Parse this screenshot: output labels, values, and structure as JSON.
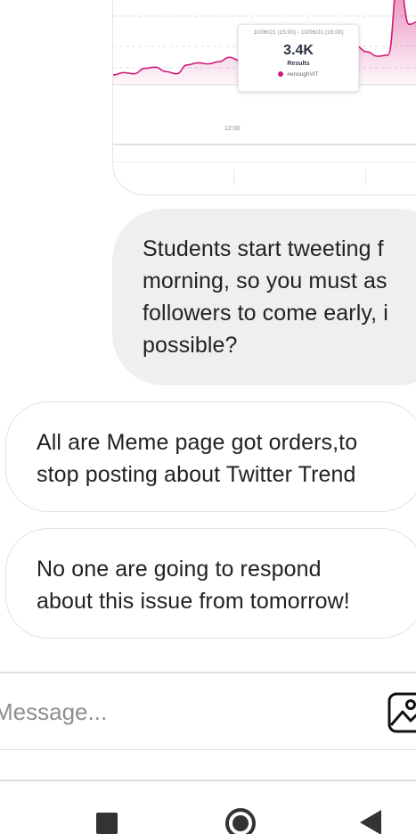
{
  "shared_image": {
    "chart_data": {
      "type": "area",
      "title": "",
      "xlabel": "",
      "ylabel": "",
      "x_tick_labels": [
        "12:00"
      ],
      "series": [
        {
          "name": "#enoughVIT",
          "values": [
            0.09,
            0.11,
            0.1,
            0.15,
            0.16,
            0.12,
            0.1,
            0.18,
            0.2,
            0.19,
            0.21,
            0.25,
            0.22,
            0.2,
            0.17,
            0.21,
            0.28,
            0.27,
            0.31,
            0.27,
            0.26,
            0.24,
            0.33,
            0.35,
            0.3,
            0.26,
            0.27,
            1.0,
            0.55,
            0.58,
            0.32
          ]
        }
      ],
      "grid": true,
      "color": "#d21b7a",
      "tooltip": {
        "range": "10/06/21 (15:00) - 10/06/21 (16:00)",
        "value": "3.4K",
        "label": "Results",
        "series": "#enoughVIT"
      }
    }
  },
  "messages": {
    "sent": [
      {
        "lines": [
          "Students start tweeting f",
          "morning, so you must as",
          "followers to come early, i",
          "possible?"
        ]
      }
    ],
    "received": [
      {
        "lines": [
          "All are Meme page got orders,to",
          "stop posting about Twitter Trend"
        ]
      },
      {
        "lines": [
          "No one are going to respond",
          "about this issue from tomorrow!"
        ]
      }
    ]
  },
  "composer": {
    "placeholder": "Message...",
    "value": "",
    "gallery_icon": "gallery-icon"
  },
  "navigation": {
    "recent_icon": "square-icon",
    "home_icon": "circle-home-icon",
    "back_icon": "triangle-back-icon"
  },
  "colors": {
    "sent_bubble": "#efefef",
    "received_border": "#e3e3e3",
    "chart_accent": "#d21b7a"
  }
}
